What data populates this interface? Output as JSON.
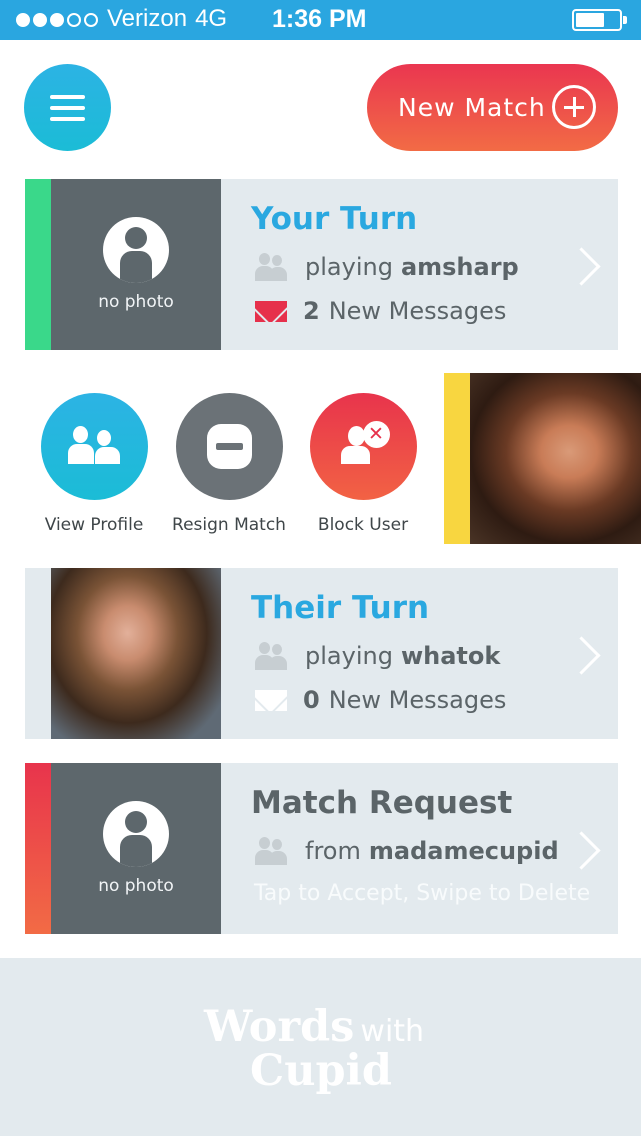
{
  "status_bar": {
    "carrier": "Verizon",
    "network": "4G",
    "time": "1:36 PM",
    "signal_bars_filled": 3,
    "signal_bars_total": 5,
    "battery_level": 0.6
  },
  "header": {
    "menu_icon": "hamburger-menu-icon",
    "new_match_label": "New Match",
    "new_match_icon": "plus-circle-icon",
    "accent_gradient": [
      "#ea3650",
      "#f26b45"
    ],
    "menu_color": "#2cb3e4"
  },
  "cards": {
    "your_turn": {
      "title": "Your Turn",
      "stripe_color": "#3ad88a",
      "photo_placeholder": "no photo",
      "playing_prefix": "playing",
      "opponent": "amsharp",
      "message_count": "2",
      "message_suffix": "New Messages"
    },
    "their_turn": {
      "title": "Their Turn",
      "playing_prefix": "playing",
      "opponent": "whatok",
      "message_count": "0",
      "message_suffix": "New Messages"
    },
    "match_request": {
      "title": "Match Request",
      "stripe_color": "#e8344c",
      "photo_placeholder": "no photo",
      "from_prefix": "from",
      "requester": "madamecupid",
      "hint": "Tap to Accept, Swipe to Delete"
    }
  },
  "swipe_actions": {
    "view_profile": "View Profile",
    "resign_match": "Resign Match",
    "block_user": "Block User",
    "swiped_stripe_color": "#f8d640"
  },
  "footer": {
    "logo_line1": "Words",
    "logo_with": "with",
    "logo_line2": "Cupid"
  }
}
